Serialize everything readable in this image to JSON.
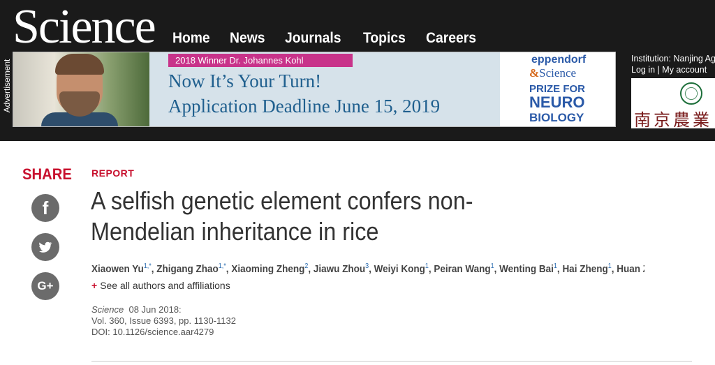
{
  "header": {
    "logo": "Science",
    "nav": [
      "Home",
      "News",
      "Journals",
      "Topics",
      "Careers"
    ],
    "ad_label": "Advertisement",
    "institution": "Institution: Nanjing Ag",
    "login": "Log in",
    "separator": "|",
    "my_account": "My account",
    "institution_logo_text": "南京農業"
  },
  "ad": {
    "winner": "2018 Winner Dr. Johannes Kohl",
    "line1": "Now It’s Your Turn!",
    "line2": "Application Deadline June 15, 2019",
    "sponsor": "eppendorf",
    "sponsor_amp": "&",
    "sponsor_science": "Science",
    "prize1": "PRIZE FOR",
    "prize2": "NEURO",
    "prize3": "BIOLOGY"
  },
  "share": {
    "label": "SHARE",
    "facebook": "f",
    "gplus": "G+"
  },
  "article": {
    "kicker": "REPORT",
    "title": "A selfish genetic element confers non-Mendelian inheritance in rice",
    "authors": [
      {
        "name": "Xiaowen Yu",
        "sup": "1,*"
      },
      {
        "name": "Zhigang Zhao",
        "sup": "1,*"
      },
      {
        "name": "Xiaoming Zheng",
        "sup": "2"
      },
      {
        "name": "Jiawu Zhou",
        "sup": "3"
      },
      {
        "name": "Weiyi Kong",
        "sup": "1"
      },
      {
        "name": "Peiran Wang",
        "sup": "1"
      },
      {
        "name": "Wenting Bai",
        "sup": "1"
      },
      {
        "name": "Hai Zheng",
        "sup": "1"
      },
      {
        "name": "Huan Zh…",
        "sup": ""
      }
    ],
    "see_all": "See all authors and affiliations",
    "see_all_plus": "+",
    "journal": "Science",
    "date": "08 Jun 2018:",
    "volume": "Vol. 360, Issue 6393, pp. 1130-1132",
    "doi": "DOI: 10.1126/science.aar4279"
  }
}
